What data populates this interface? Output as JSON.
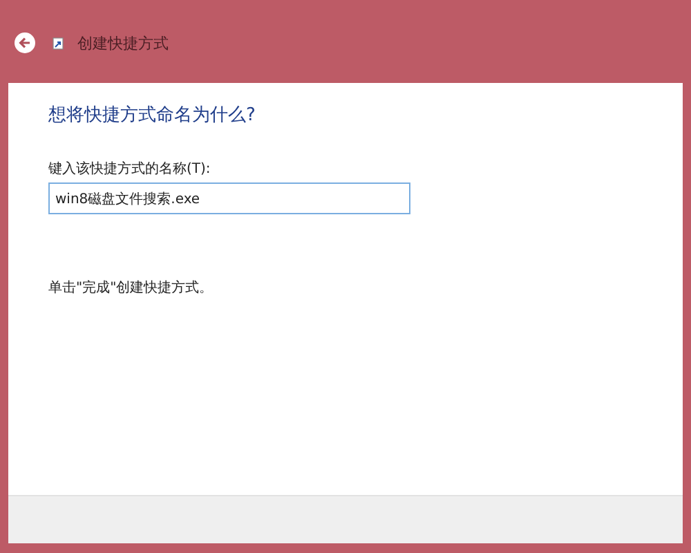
{
  "window": {
    "title": "创建快捷方式"
  },
  "heading": "想将快捷方式命名为什么?",
  "name_field": {
    "label": "键入该快捷方式的名称(T):",
    "value": "win8磁盘文件搜索.exe"
  },
  "hint": "单击\"完成\"创建快捷方式。"
}
